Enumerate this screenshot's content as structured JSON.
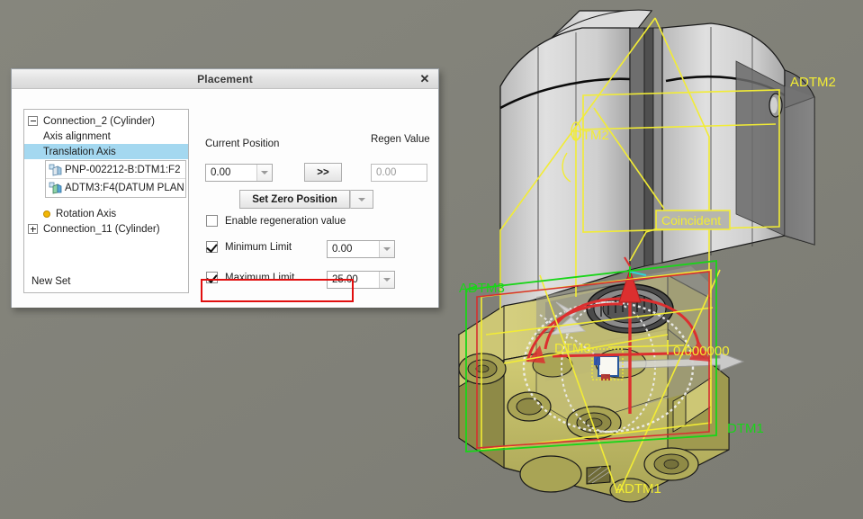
{
  "app": {
    "background_color": "#828279",
    "viewport_name": "3d-model-viewport"
  },
  "dialog": {
    "title": "Placement",
    "close_label": "✕",
    "tree": {
      "nodes": [
        {
          "label": "Connection_2 (Cylinder)",
          "expander": "minus",
          "level": 0
        },
        {
          "label": "Axis alignment",
          "expander": "none",
          "level": 1
        },
        {
          "label": "Translation Axis",
          "expander": "none",
          "level": 1,
          "selected": true
        }
      ],
      "references": [
        {
          "label": "PNP-002212-B:DTM1:F2",
          "icon": "datum-plane-icon"
        },
        {
          "label": "ADTM3:F4(DATUM PLAN",
          "icon": "datum-plane-icon"
        }
      ],
      "nodes_after": [
        {
          "label": "Rotation Axis",
          "expander": "dot",
          "level": 1
        },
        {
          "label": "Connection_11 (Cylinder)",
          "expander": "plus",
          "level": 0
        }
      ],
      "new_set_label": "New Set"
    },
    "controls": {
      "current_position_label": "Current Position",
      "current_position_value": "0.00",
      "regen_value_label": "Regen Value",
      "regen_value_placeholder": "0.00",
      "forward_button_label": ">>",
      "set_zero_button_label": "Set Zero Position",
      "enable_regen_label": "Enable regeneration value",
      "enable_regen_checked": false,
      "minimum_limit_label": "Minimum Limit",
      "minimum_limit_checked": true,
      "minimum_limit_value": "0.00",
      "maximum_limit_label": "Maximum Limit",
      "maximum_limit_checked": true,
      "maximum_limit_value": "25.00"
    },
    "highlight": {
      "name": "enable-regeneration-value-highlight",
      "color": "#e10f0f"
    }
  },
  "viewport_labels": {
    "adtm2": "ADTM2",
    "dtm2": "DTM2",
    "coincident": "Coincident",
    "adtm3": "ADTM3",
    "dtm3": "DTM3",
    "dtm1": "DTM1",
    "adtm1": "ADTM1",
    "dimension_value": "0.000000"
  },
  "colors": {
    "datum_yellow": "#f2ec35",
    "datum_green": "#19d519",
    "drag_red": "#e03030",
    "selection_blue": "#a4d8f0",
    "body_light": "#d2d2d2",
    "body_dark": "#8d8d8d",
    "body_gold": "#c8c264"
  }
}
